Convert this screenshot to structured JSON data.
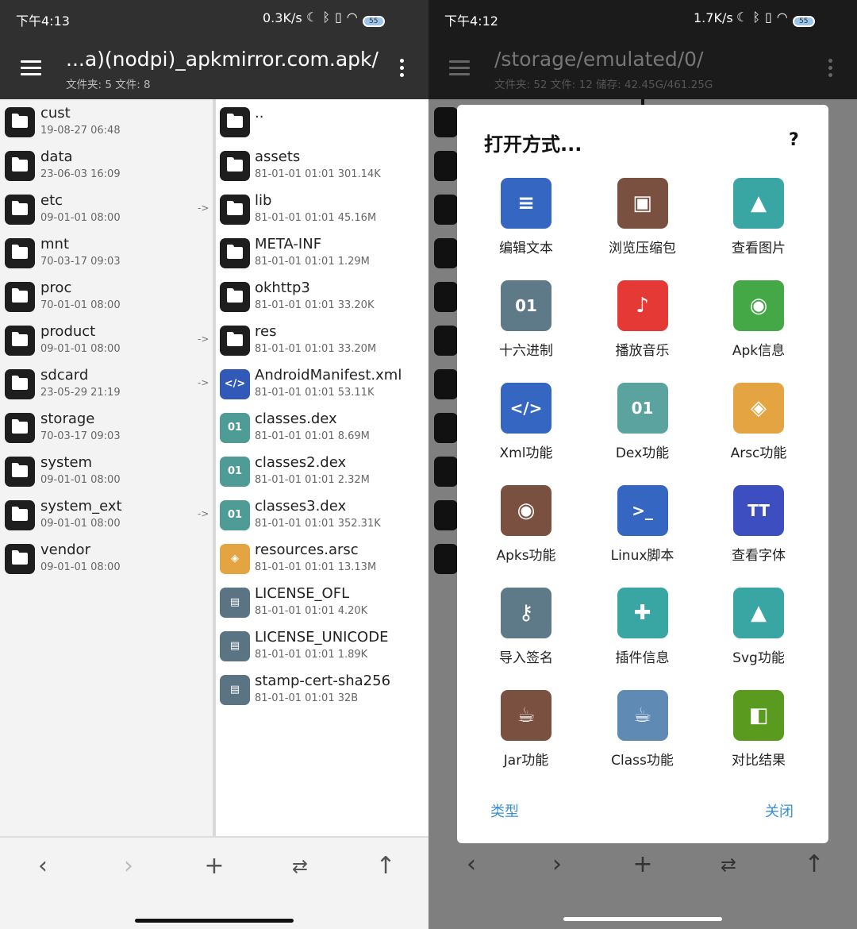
{
  "left": {
    "status": {
      "time": "下午4:13",
      "speed": "0.3K/s",
      "battery": "55"
    },
    "header": {
      "path": "...a)(nodpi)_apkmirror.com.apk/",
      "summary": "文件夹: 5   文件: 8"
    },
    "left_pane": [
      {
        "name": "cust",
        "meta": "19-08-27 06:48",
        "link": false
      },
      {
        "name": "data",
        "meta": "23-06-03 16:09",
        "link": false
      },
      {
        "name": "etc",
        "meta": "09-01-01 08:00",
        "link": true
      },
      {
        "name": "mnt",
        "meta": "70-03-17 09:03",
        "link": false
      },
      {
        "name": "proc",
        "meta": "70-01-01 08:00",
        "link": false
      },
      {
        "name": "product",
        "meta": "09-01-01 08:00",
        "link": true
      },
      {
        "name": "sdcard",
        "meta": "23-05-29 21:19",
        "link": true
      },
      {
        "name": "storage",
        "meta": "70-03-17 09:03",
        "link": false
      },
      {
        "name": "system",
        "meta": "09-01-01 08:00",
        "link": false
      },
      {
        "name": "system_ext",
        "meta": "09-01-01 08:00",
        "link": true
      },
      {
        "name": "vendor",
        "meta": "09-01-01 08:00",
        "link": false
      }
    ],
    "link_arrow": "->",
    "right_pane": [
      {
        "name": "..",
        "meta": "",
        "type": "folder"
      },
      {
        "name": "assets",
        "meta": "81-01-01 01:01  301.14K",
        "type": "folder"
      },
      {
        "name": "lib",
        "meta": "81-01-01 01:01  45.16M",
        "type": "folder"
      },
      {
        "name": "META-INF",
        "meta": "81-01-01 01:01  1.29M",
        "type": "folder"
      },
      {
        "name": "okhttp3",
        "meta": "81-01-01 01:01  33.20K",
        "type": "folder"
      },
      {
        "name": "res",
        "meta": "81-01-01 01:01  33.20M",
        "type": "folder"
      },
      {
        "name": "AndroidManifest.xml",
        "meta": "81-01-01 01:01  53.11K",
        "type": "xml"
      },
      {
        "name": "classes.dex",
        "meta": "81-01-01 01:01  8.69M",
        "type": "dex"
      },
      {
        "name": "classes2.dex",
        "meta": "81-01-01 01:01  2.32M",
        "type": "dex"
      },
      {
        "name": "classes3.dex",
        "meta": "81-01-01 01:01  352.31K",
        "type": "dex"
      },
      {
        "name": "resources.arsc",
        "meta": "81-01-01 01:01  13.13M",
        "type": "arsc"
      },
      {
        "name": "LICENSE_OFL",
        "meta": "81-01-01 01:01  4.20K",
        "type": "file"
      },
      {
        "name": "LICENSE_UNICODE",
        "meta": "81-01-01 01:01  1.89K",
        "type": "file"
      },
      {
        "name": "stamp-cert-sha256",
        "meta": "81-01-01 01:01  32B",
        "type": "file"
      }
    ]
  },
  "right": {
    "status": {
      "time": "下午4:12",
      "speed": "1.7K/s",
      "battery": "55"
    },
    "header": {
      "path": "/storage/emulated/0/",
      "summary": "文件夹: 52   文件: 12   储存: 42.45G/461.25G"
    },
    "dialog": {
      "title": "打开方式...",
      "help": "?",
      "items": [
        {
          "label": "编辑文本",
          "icon": "text-file-icon",
          "color": "#3566c2",
          "glyph": "≡"
        },
        {
          "label": "浏览压缩包",
          "icon": "archive-icon",
          "color": "#7a5040",
          "glyph": "▣"
        },
        {
          "label": "查看图片",
          "icon": "image-icon",
          "color": "#3aa6a4",
          "glyph": "▲"
        },
        {
          "label": "十六进制",
          "icon": "hex-file-icon",
          "color": "#5e7987",
          "glyph": "01"
        },
        {
          "label": "播放音乐",
          "icon": "music-icon",
          "color": "#e53935",
          "glyph": "♪"
        },
        {
          "label": "Apk信息",
          "icon": "android-icon",
          "color": "#45a846",
          "glyph": "◉"
        },
        {
          "label": "Xml功能",
          "icon": "xml-file-icon",
          "color": "#3566c2",
          "glyph": "</>"
        },
        {
          "label": "Dex功能",
          "icon": "dex-file-icon",
          "color": "#5aa39e",
          "glyph": "01"
        },
        {
          "label": "Arsc功能",
          "icon": "layers-icon",
          "color": "#e3a441",
          "glyph": "◈"
        },
        {
          "label": "Apks功能",
          "icon": "android-icon",
          "color": "#7a5040",
          "glyph": "◉"
        },
        {
          "label": "Linux脚本",
          "icon": "script-icon",
          "color": "#3566c2",
          "glyph": ">_"
        },
        {
          "label": "查看字体",
          "icon": "font-icon",
          "color": "#3d4fc0",
          "glyph": "TT"
        },
        {
          "label": "导入签名",
          "icon": "key-icon",
          "color": "#5e7987",
          "glyph": "⚷"
        },
        {
          "label": "插件信息",
          "icon": "puzzle-icon",
          "color": "#3aa6a4",
          "glyph": "✚"
        },
        {
          "label": "Svg功能",
          "icon": "image-icon",
          "color": "#3aa6a4",
          "glyph": "▲"
        },
        {
          "label": "Jar功能",
          "icon": "coffee-icon",
          "color": "#7a5040",
          "glyph": "☕"
        },
        {
          "label": "Class功能",
          "icon": "coffee-icon",
          "color": "#5e8ab4",
          "glyph": "☕"
        },
        {
          "label": "对比结果",
          "icon": "compare-icon",
          "color": "#5a9b1f",
          "glyph": "◧"
        }
      ],
      "left_button": "类型",
      "right_button": "关闭"
    }
  }
}
